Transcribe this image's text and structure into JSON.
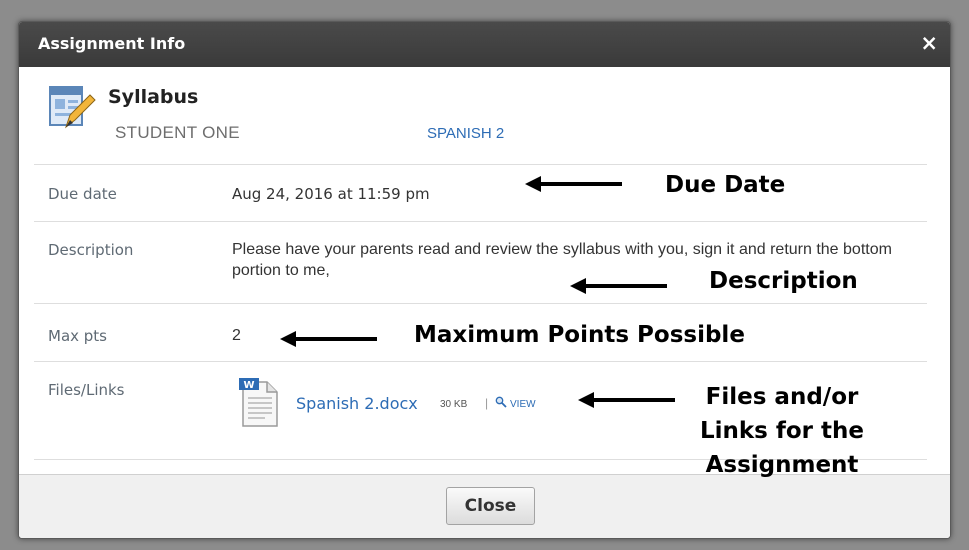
{
  "dialog": {
    "title": "Assignment Info",
    "close_icon_glyph": "×",
    "footer": {
      "close_label": "Close"
    }
  },
  "assignment": {
    "icon": "assignment-pencil-icon",
    "title": "Syllabus",
    "student": "STUDENT ONE",
    "course": "SPANISH 2"
  },
  "fields": {
    "due_date": {
      "label": "Due date",
      "value": "Aug 24, 2016 at 11:59 pm"
    },
    "description": {
      "label": "Description",
      "value": "Please have your parents read and review the syllabus with you, sign it and return the bottom portion to me,"
    },
    "max_pts": {
      "label": "Max pts",
      "value": "2"
    },
    "files": {
      "label": "Files/Links",
      "items": [
        {
          "icon": "word-document-icon",
          "name": "Spanish 2.docx",
          "size": "30 KB",
          "separator": "|",
          "view_label": "VIEW",
          "view_icon": "magnifier-icon"
        }
      ]
    }
  },
  "annotations": {
    "due_date": "Due Date",
    "description": "Description",
    "max_points": "Maximum Points Possible",
    "files_line1": "Files and/or",
    "files_line2": "Links for the",
    "files_line3": "Assignment"
  },
  "colors": {
    "titlebar": "#3e3e3e",
    "link": "#2d6cb5",
    "backdrop": "#8c8c8c"
  }
}
